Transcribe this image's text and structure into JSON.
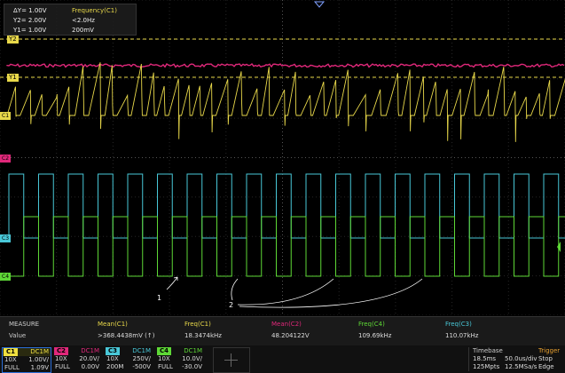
{
  "cursor": {
    "dy": "ΔY= 1.00V",
    "y2": "Y2= 2.00V",
    "y1": "Y1= 1.00V",
    "freq_title": "Frequency(C1)",
    "freq_value": "<2.0Hz",
    "freq_sub": "200mV"
  },
  "markers": {
    "y2": "Y2",
    "y1": "Y1",
    "c1": "C1",
    "c2": "C2",
    "c3": "C3",
    "c4": "C4"
  },
  "annotations": {
    "label1": "1",
    "label2": "2"
  },
  "measure": {
    "title": "MEASURE",
    "row_label": "Value",
    "items": [
      {
        "name": "Mean(C1)",
        "value": ">368.4438mV (↑)",
        "color": "#e8d84a"
      },
      {
        "name": "Freq(C1)",
        "value": "18.3474kHz",
        "color": "#e8d84a"
      },
      {
        "name": "Mean(C2)",
        "value": "48.204122V",
        "color": "#e0287a"
      },
      {
        "name": "Freq(C4)",
        "value": "109.69kHz",
        "color": "#5ed836"
      },
      {
        "name": "Freq(C3)",
        "value": "110.07kHz",
        "color": "#49c8d8"
      }
    ]
  },
  "channels": [
    {
      "tag": "C1",
      "color": "#f0e040",
      "coupling": "DC1M",
      "probe": "10X",
      "scale": "1.00V/",
      "bw": "FULL",
      "offset": "1.09V"
    },
    {
      "tag": "C2",
      "color": "#e0287a",
      "coupling": "DC1M",
      "probe": "10X",
      "scale": "20.0V/",
      "bw": "FULL",
      "offset": "0.00V"
    },
    {
      "tag": "C3",
      "color": "#49c8d8",
      "coupling": "DC1M",
      "probe": "10X",
      "scale": "250V/",
      "bw": "200M",
      "offset": "-500V"
    },
    {
      "tag": "C4",
      "color": "#5ed836",
      "coupling": "DC1M",
      "probe": "10X",
      "scale": "10.0V/",
      "bw": "FULL",
      "offset": "-30.0V"
    }
  ],
  "timebase": {
    "title": "Timebase",
    "delay": "18.5ms",
    "scale": "50.0us/div",
    "points": "125Mpts",
    "rate": "12.5MSa/s"
  },
  "trigger": {
    "title": "Trigger",
    "mode": "Stop",
    "type": "Edge"
  }
}
